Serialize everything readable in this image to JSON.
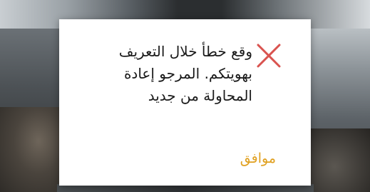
{
  "dialog": {
    "message_lines": [
      "وقع خطأ خلال التعريف",
      "بهويتكم. المرجو إعادة",
      "المحاولة من جديد"
    ],
    "icon": "error-x-icon",
    "ok_label": "موافق"
  },
  "colors": {
    "accent": "#e0a020",
    "error_icon": "#d9534f"
  }
}
